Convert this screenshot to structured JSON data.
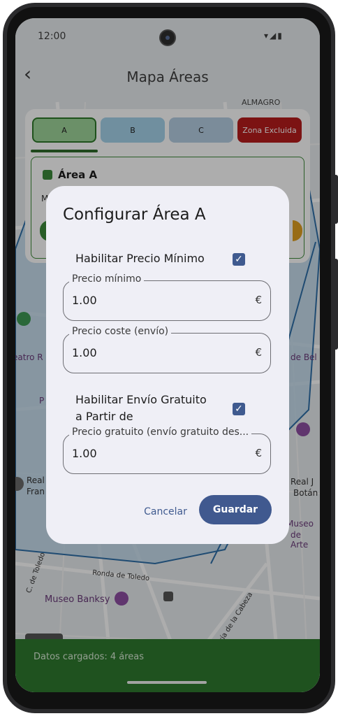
{
  "status_bar": {
    "time": "12:00",
    "icons": "▾◢▮"
  },
  "app_bar": {
    "back_icon": "‹",
    "title": "Mapa Áreas"
  },
  "map": {
    "labels": [
      "ALMAGRO",
      "eatro R",
      "Real",
      "Fran",
      "Real J",
      "Botán",
      "Museo",
      "de Arte",
      "de Bel",
      "Museo Banksy",
      "Ronda de Toledo",
      "C. de Toledo",
      "ría de la Cabeza",
      "P"
    ]
  },
  "panel": {
    "tabs": [
      {
        "label": "A",
        "color": "#9ed59a"
      },
      {
        "label": "B",
        "color": "#a5d3ea"
      },
      {
        "label": "C",
        "color": "#b6cfe3"
      },
      {
        "label": "Zona Excluida",
        "color": "#b71c1c"
      }
    ],
    "area_name": "Área A",
    "partial_text": "M"
  },
  "dialog": {
    "title": "Configurar Área A",
    "enable_min_price": {
      "label": "Habilitar Precio Mínimo",
      "checked": true
    },
    "fields": [
      {
        "label": "Precio mínimo",
        "value": "1.00",
        "suffix": "€"
      },
      {
        "label": "Precio coste (envío)",
        "value": "1.00",
        "suffix": "€"
      },
      {
        "label": "Precio gratuito (envío gratuito des...",
        "value": "1.00",
        "suffix": "€"
      }
    ],
    "enable_free_shipping": {
      "label": "Habilitar Envío Gratuito a Partir de",
      "checked": true
    },
    "cancel_label": "Cancelar",
    "save_label": "Guardar",
    "check_glyph": "✓"
  },
  "bottom_bar": {
    "text": "Datos cargados: 4 áreas"
  },
  "colors": {
    "accent": "#40598f",
    "area_green": "#3b8a3a",
    "excluded_red": "#b71c1c"
  }
}
